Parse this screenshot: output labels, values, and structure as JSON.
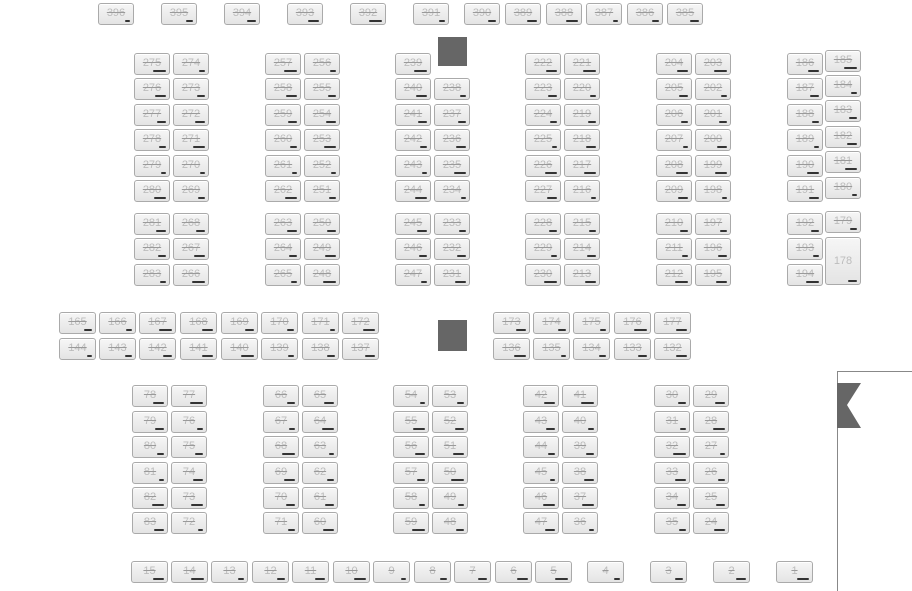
{
  "legend_colors": {
    "booth_fill": "#ececec",
    "booth_border": "#aaaaaa",
    "label": "#bcbcbc",
    "pillar": "#666666"
  },
  "icons": [
    "entrance-icon"
  ],
  "top_row": [
    "396",
    "395",
    "394",
    "393",
    "392",
    "391",
    "390",
    "389",
    "388",
    "387",
    "386",
    "385"
  ],
  "block_a": {
    "left": [
      "275",
      "276",
      "277",
      "278",
      "279",
      "280",
      "281",
      "282",
      "283"
    ],
    "right": [
      "274",
      "273",
      "272",
      "271",
      "270",
      "269",
      "268",
      "267",
      "266"
    ]
  },
  "block_b": {
    "left": [
      "257",
      "258",
      "259",
      "260",
      "261",
      "262",
      "263",
      "264",
      "265"
    ],
    "right": [
      "256",
      "255",
      "254",
      "253",
      "252",
      "251",
      "250",
      "249",
      "248"
    ]
  },
  "block_c": {
    "left": [
      "239",
      "240",
      "241",
      "242",
      "243",
      "244",
      "245",
      "246",
      "247"
    ],
    "right": [
      "238",
      "237",
      "236",
      "235",
      "234",
      "233",
      "232",
      "231"
    ]
  },
  "block_d": {
    "left": [
      "222",
      "223",
      "224",
      "225",
      "226",
      "227",
      "228",
      "229",
      "230"
    ],
    "right": [
      "221",
      "220",
      "219",
      "218",
      "217",
      "216",
      "215",
      "214",
      "213"
    ]
  },
  "block_e": {
    "left": [
      "204",
      "205",
      "206",
      "207",
      "208",
      "209",
      "210",
      "211",
      "212"
    ],
    "right": [
      "203",
      "202",
      "201",
      "200",
      "199",
      "198",
      "197",
      "196",
      "195"
    ]
  },
  "block_f": {
    "left": [
      "186",
      "187",
      "188",
      "189",
      "190",
      "191",
      "192",
      "193",
      "194"
    ],
    "right": [
      "185",
      "184",
      "183",
      "182",
      "181",
      "180",
      "179",
      "178"
    ]
  },
  "middle_left_top": [
    "165",
    "166",
    "167",
    "168",
    "169",
    "170",
    "171",
    "172"
  ],
  "middle_left_bottom": [
    "144",
    "143",
    "142",
    "141",
    "140",
    "139",
    "138",
    "137"
  ],
  "middle_right_top": [
    "173",
    "174",
    "175",
    "176",
    "177"
  ],
  "middle_right_bottom": [
    "136",
    "135",
    "134",
    "133",
    "132"
  ],
  "lower_blocks": [
    {
      "left": [
        "78",
        "79",
        "80",
        "81",
        "82",
        "83"
      ],
      "right": [
        "77",
        "76",
        "75",
        "74",
        "73",
        "72"
      ]
    },
    {
      "left": [
        "66",
        "67",
        "68",
        "69",
        "70",
        "71"
      ],
      "right": [
        "65",
        "64",
        "63",
        "62",
        "61",
        "60"
      ]
    },
    {
      "left": [
        "54",
        "55",
        "56",
        "57",
        "58",
        "59"
      ],
      "right": [
        "53",
        "52",
        "51",
        "50",
        "49",
        "48"
      ]
    },
    {
      "left": [
        "42",
        "43",
        "44",
        "45",
        "46",
        "47"
      ],
      "right": [
        "41",
        "40",
        "39",
        "38",
        "37",
        "36"
      ]
    },
    {
      "left": [
        "30",
        "31",
        "32",
        "33",
        "34",
        "35"
      ],
      "right": [
        "29",
        "28",
        "27",
        "26",
        "25",
        "24"
      ]
    }
  ],
  "bottom_row": [
    "15",
    "14",
    "13",
    "12",
    "11",
    "10",
    "9",
    "8",
    "7",
    "6",
    "5",
    "4",
    "3",
    "2",
    "1"
  ]
}
